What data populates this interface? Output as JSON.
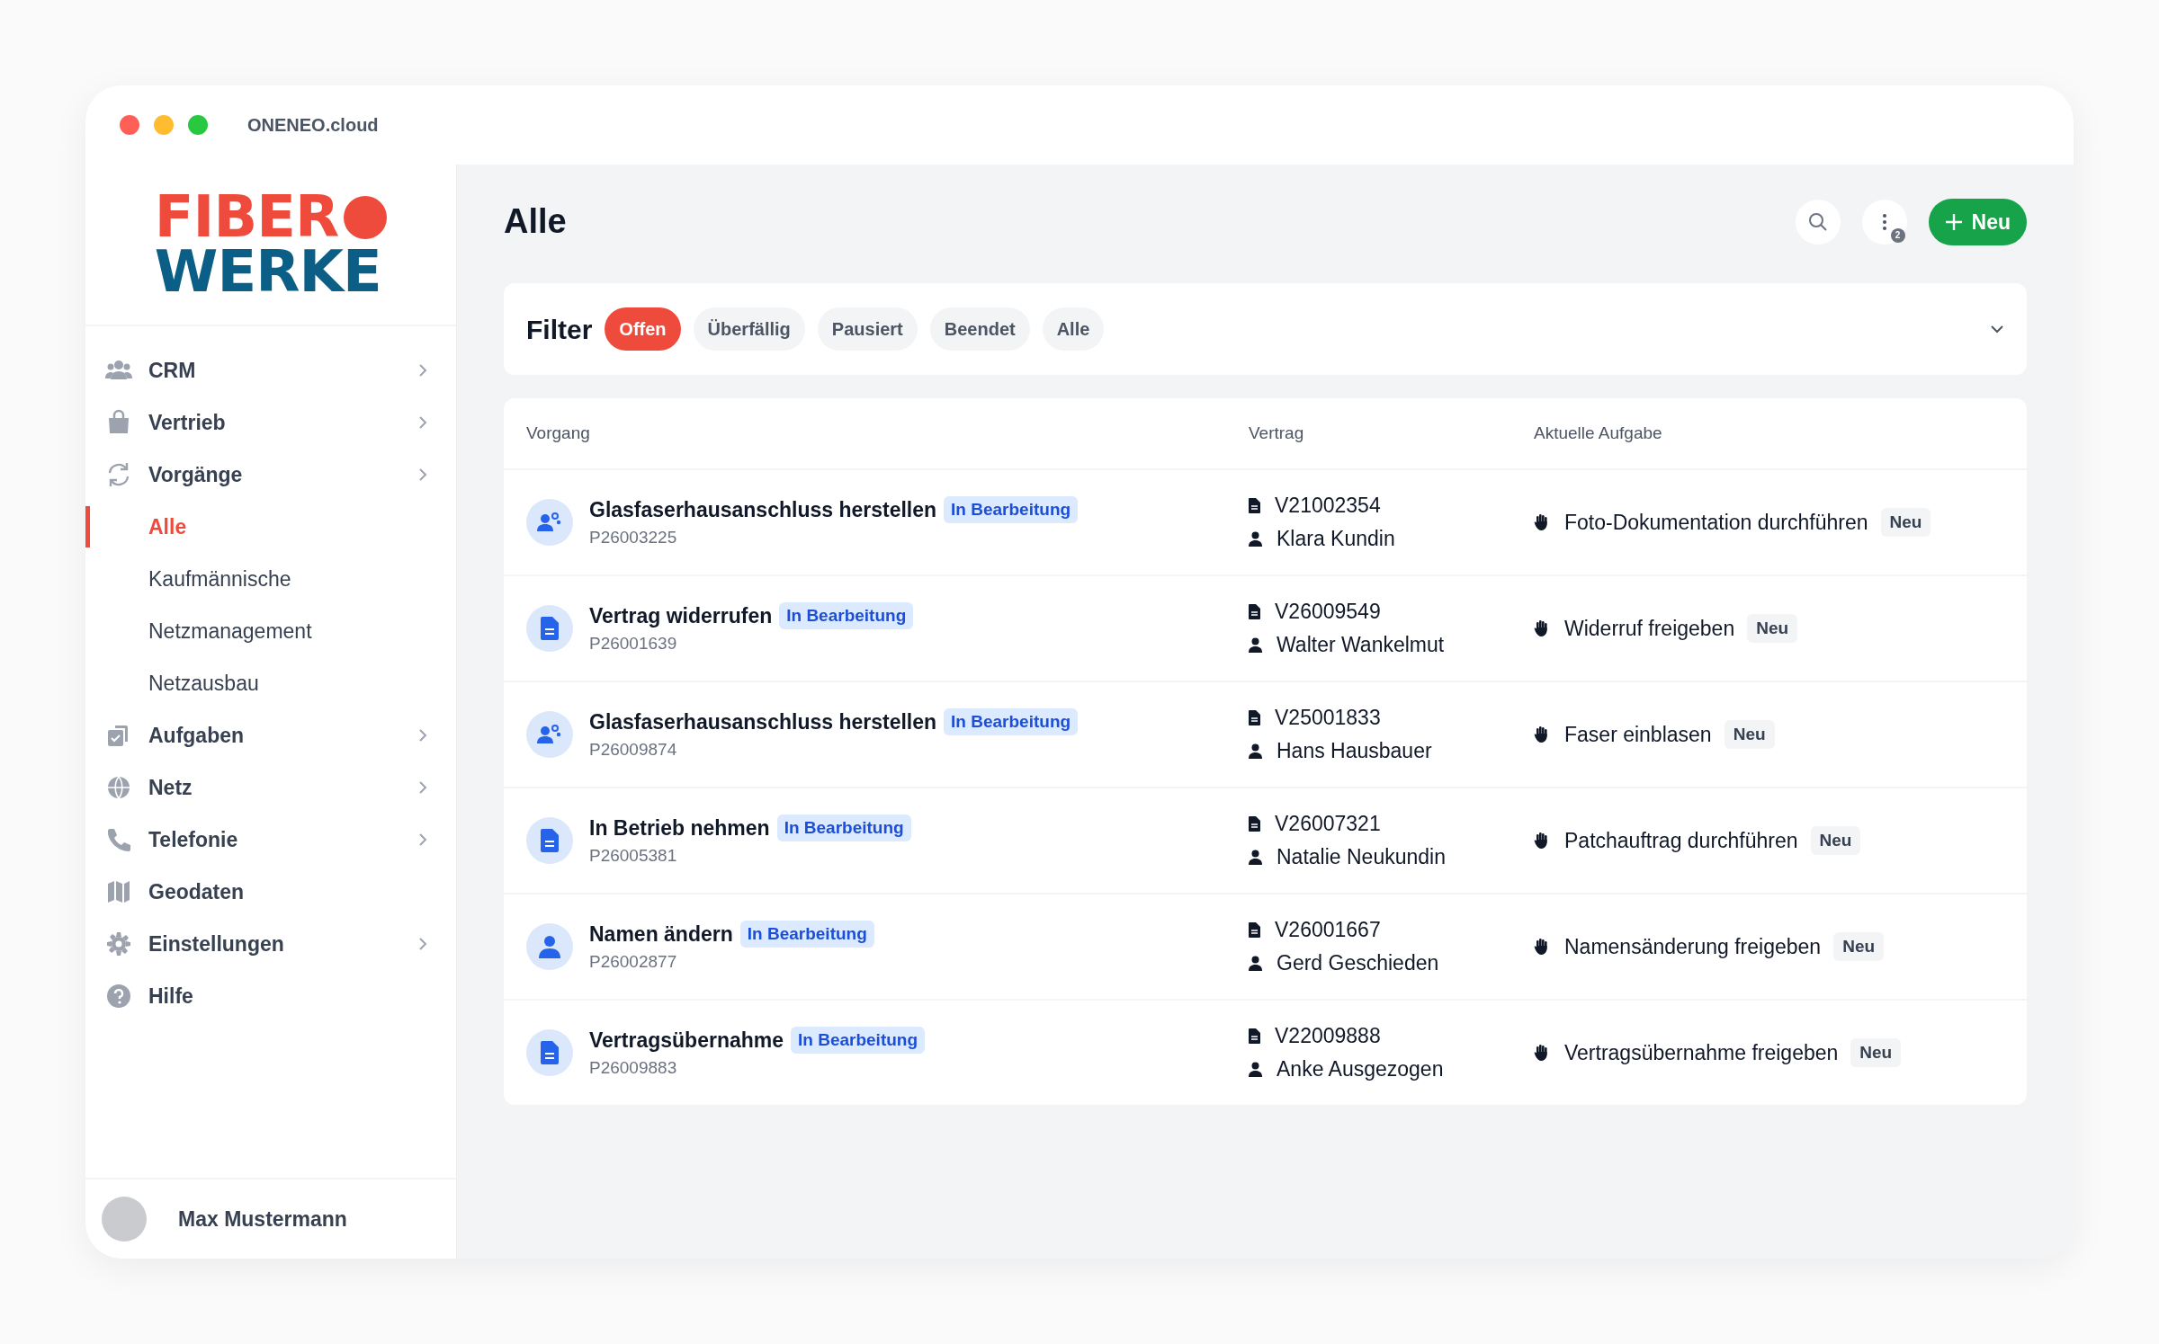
{
  "window": {
    "title": "ONENEO.cloud"
  },
  "logo": {
    "line_1": "FIBER",
    "line_2": "WERKE"
  },
  "sidebar": {
    "items": [
      {
        "label": "CRM",
        "kind": "group"
      },
      {
        "label": "Vertrieb",
        "kind": "group"
      },
      {
        "label": "Vorgänge",
        "kind": "group",
        "children": [
          {
            "label": "Alle",
            "selected": true
          },
          {
            "label": "Kaufmännische",
            "selected": false
          },
          {
            "label": "Netzmanagement",
            "selected": false
          },
          {
            "label": "Netzausbau",
            "selected": false
          }
        ]
      },
      {
        "label": "Aufgaben",
        "kind": "group"
      },
      {
        "label": "Netz",
        "kind": "group"
      },
      {
        "label": "Telefonie",
        "kind": "group"
      },
      {
        "label": "Geodaten",
        "kind": "link"
      },
      {
        "label": "Einstellungen",
        "kind": "group"
      },
      {
        "label": "Hilfe",
        "kind": "link"
      }
    ],
    "user": {
      "name": "Max Mustermann"
    }
  },
  "page": {
    "title": "Alle",
    "more_badge": "2",
    "new_button": "Neu"
  },
  "filter": {
    "label": "Filter",
    "chips": [
      {
        "label": "Offen",
        "selected": true
      },
      {
        "label": "Überfällig",
        "selected": false
      },
      {
        "label": "Pausiert",
        "selected": false
      },
      {
        "label": "Beendet",
        "selected": false
      },
      {
        "label": "Alle",
        "selected": false
      }
    ]
  },
  "table": {
    "columns": [
      "Vorgang",
      "Vertrag",
      "Aktuelle Aufgabe"
    ],
    "rows": [
      {
        "kind": "team",
        "title": "Glasfaserhausanschluss herstellen",
        "status": "In Bearbeitung",
        "id": "P26003225",
        "contract": "V21002354",
        "customer": "Klara Kundin",
        "task": "Foto-Dokumentation durchführen",
        "task_badge": "Neu"
      },
      {
        "kind": "document",
        "title": "Vertrag widerrufen",
        "status": "In Bearbeitung",
        "id": "P26001639",
        "contract": "V26009549",
        "customer": "Walter Wankelmut",
        "task": "Widerruf freigeben",
        "task_badge": "Neu"
      },
      {
        "kind": "team",
        "title": "Glasfaserhausanschluss herstellen",
        "status": "In Bearbeitung",
        "id": "P26009874",
        "contract": "V25001833",
        "customer": "Hans Hausbauer",
        "task": "Faser einblasen",
        "task_badge": "Neu"
      },
      {
        "kind": "document",
        "title": "In Betrieb nehmen",
        "status": "In Bearbeitung",
        "id": "P26005381",
        "contract": "V26007321",
        "customer": "Natalie Neukundin",
        "task": "Patchauftrag durchführen",
        "task_badge": "Neu"
      },
      {
        "kind": "person",
        "title": "Namen ändern",
        "status": "In Bearbeitung",
        "id": "P26002877",
        "contract": "V26001667",
        "customer": "Gerd Geschieden",
        "task": "Namensänderung freigeben",
        "task_badge": "Neu"
      },
      {
        "kind": "document",
        "title": "Vertragsübernahme",
        "status": "In Bearbeitung",
        "id": "P26009883",
        "contract": "V22009888",
        "customer": "Anke Ausgezogen",
        "task": "Vertragsübernahme freigeben",
        "task_badge": "Neu"
      }
    ]
  }
}
